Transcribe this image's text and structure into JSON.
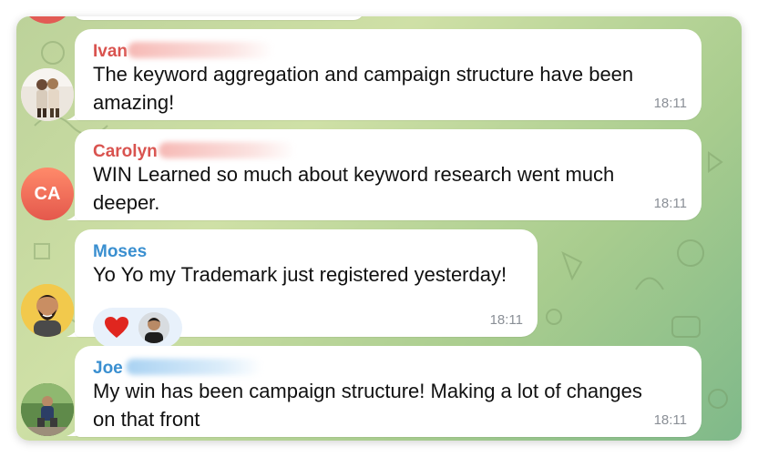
{
  "messages": [
    {
      "sender": "Ivan",
      "text_line1": "The keyword aggregation and campaign structure have been",
      "text_line2": "amazing!",
      "time": "18:11",
      "name_color": "#d9534f"
    },
    {
      "sender": "Carolyn",
      "avatar_initials": "CA",
      "text_line1": "WIN Learned so much about keyword research went much",
      "text_line2": "deeper.",
      "time": "18:11",
      "name_color": "#d9534f"
    },
    {
      "sender": "Moses",
      "text_line1": "Yo Yo my Trademark just registered yesterday!",
      "time": "18:11",
      "name_color": "#3a8fd0",
      "reactions": [
        "heart-icon",
        "user-avatar"
      ]
    },
    {
      "sender": "Joe",
      "text_line1": "My win has been campaign structure! Making a lot of changes",
      "text_line2": "on that front",
      "time": "18:11",
      "name_color": "#3a8fd0"
    }
  ]
}
